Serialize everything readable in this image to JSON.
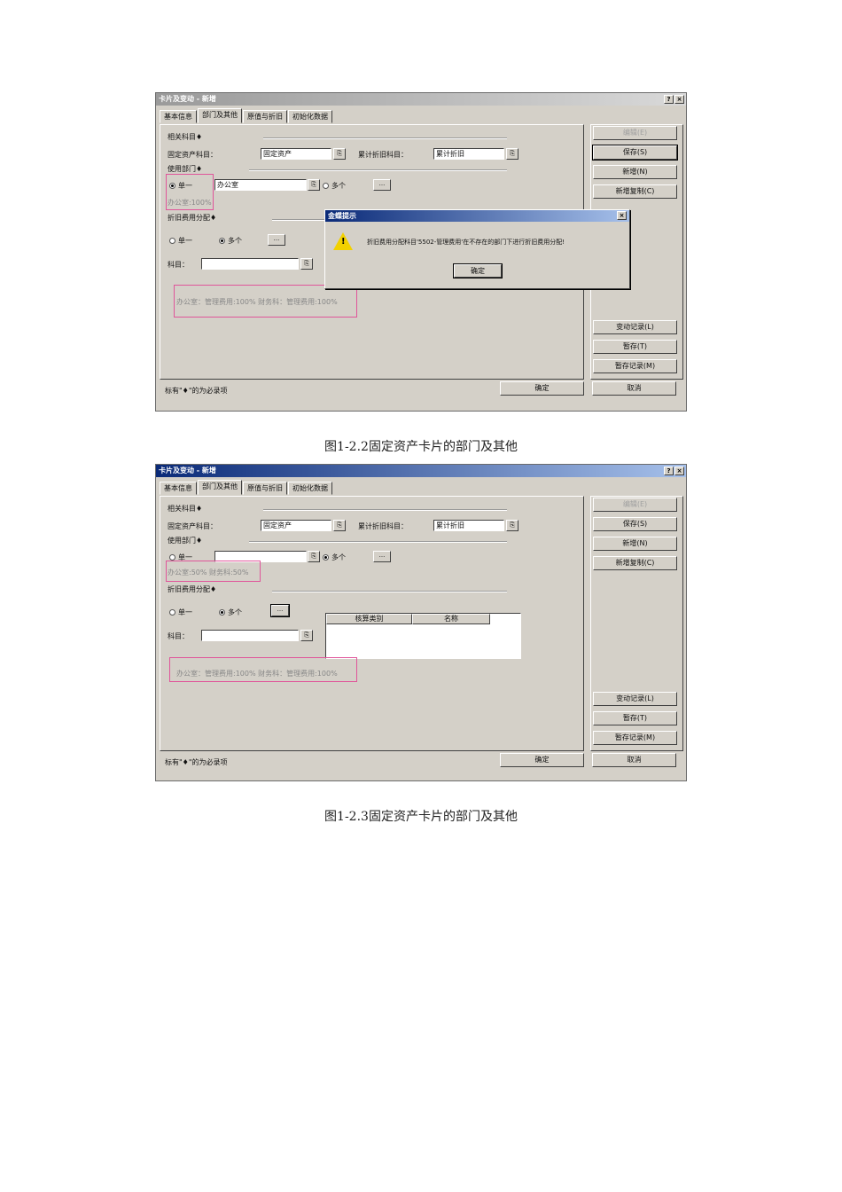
{
  "figures": [
    {
      "window_title": "卡片及变动 - 新增",
      "help_btn": "?",
      "close_btn": "×",
      "tabs": [
        "基本信息",
        "部门及其他",
        "原值与折旧",
        "初始化数据"
      ],
      "related_subjects_label": "相关科目♦",
      "fixed_asset_subject_label": "固定资产科目：",
      "fixed_asset_subject_value": "固定资产",
      "accum_dep_subject_label": "累计折旧科目：",
      "accum_dep_subject_value": "累计折旧",
      "use_dept_label": "使用部门♦",
      "single_label": "单一",
      "multiple_label": "多个",
      "dept_value": "办公室",
      "dept_alloc_text": "办公室:100%",
      "dep_alloc_label": "折旧费用分配♦",
      "subject_label": "科目：",
      "subject_value": "",
      "expense_alloc_text": "办公室：管理费用:100% 财务科：管理费用:100%",
      "ellipsis": "...",
      "lookup_icon": "lookup-icon",
      "side_buttons": [
        "编辑(E)",
        "保存(S)",
        "新增(N)",
        "新增复制(C)"
      ],
      "side_buttons_bottom": [
        "变动记录(L)",
        "暂存(T)",
        "暂存记录(M)"
      ],
      "required_note": "标有\"♦\"的为必录项",
      "ok_label": "确定",
      "cancel_label": "取消",
      "dialog": {
        "title": "金蝶提示",
        "message": "折旧费用分配科目'5502-管理费用'在不存在的部门下进行折旧费用分配!",
        "ok_label": "确定",
        "close_btn": "×",
        "icon": "warning-icon"
      }
    },
    {
      "window_title": "卡片及变动 - 新增",
      "help_btn": "?",
      "close_btn": "×",
      "tabs": [
        "基本信息",
        "部门及其他",
        "原值与折旧",
        "初始化数据"
      ],
      "related_subjects_label": "相关科目♦",
      "fixed_asset_subject_label": "固定资产科目：",
      "fixed_asset_subject_value": "固定资产",
      "accum_dep_subject_label": "累计折旧科目：",
      "accum_dep_subject_value": "累计折旧",
      "use_dept_label": "使用部门♦",
      "single_label": "单一",
      "multiple_label": "多个",
      "dept_value": "",
      "dept_alloc_text": "办公室:50% 财务科:50%",
      "dep_alloc_label": "折旧费用分配♦",
      "subject_label": "科目：",
      "subject_value": "",
      "grid_headers": [
        "核算类别",
        "名称"
      ],
      "expense_alloc_text": "办公室：管理费用:100% 财务科：管理费用:100%",
      "ellipsis": "...",
      "lookup_icon": "lookup-icon",
      "side_buttons": [
        "编辑(E)",
        "保存(S)",
        "新增(N)",
        "新增复制(C)"
      ],
      "side_buttons_bottom": [
        "变动记录(L)",
        "暂存(T)",
        "暂存记录(M)"
      ],
      "required_note": "标有\"♦\"的为必录项",
      "ok_label": "确定",
      "cancel_label": "取消"
    }
  ],
  "captions": [
    "图1-2.2固定资产卡片的部门及其他",
    "图1-2.3固定资产卡片的部门及其他"
  ],
  "colors": {
    "highlight": "#e0559a",
    "window_bg": "#d4d0c8",
    "titlebar": "#0a2a78",
    "warning": "#f2d100"
  }
}
